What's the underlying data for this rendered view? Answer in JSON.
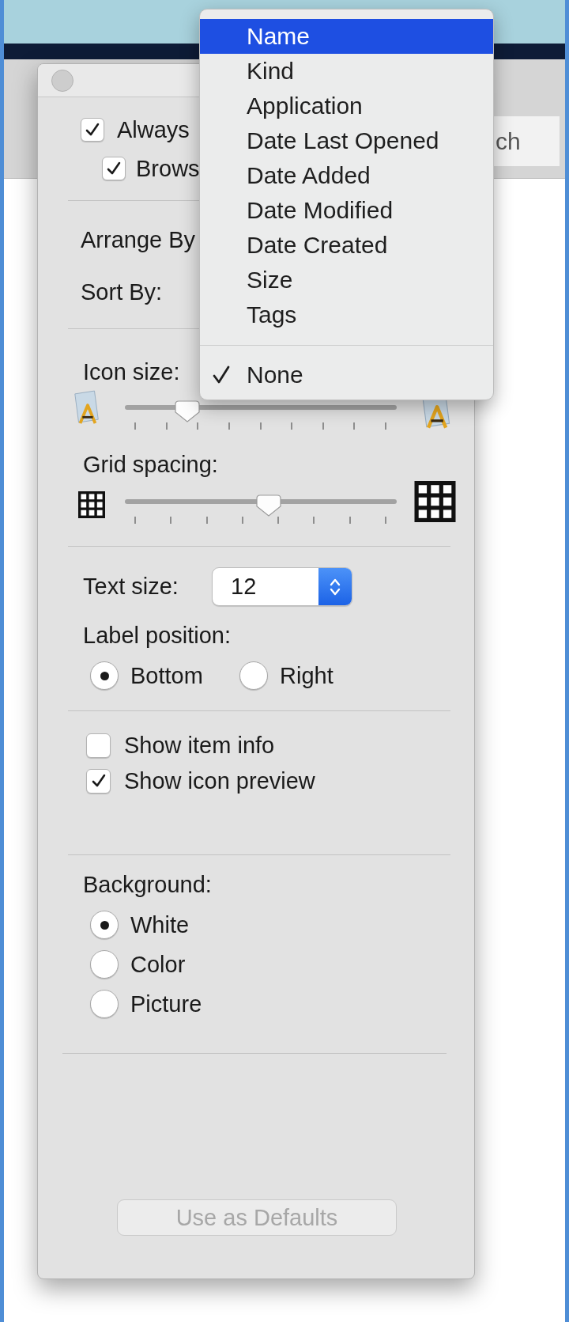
{
  "finder_window": {
    "search_field": {
      "placeholder": "ch"
    }
  },
  "view_options": {
    "checkboxes": [
      {
        "label": "Always",
        "checked": true,
        "children": [
          {
            "label": "Brows",
            "checked": true
          }
        ]
      }
    ],
    "arrange_by": {
      "label": "Arrange By"
    },
    "sort_by": {
      "label": "Sort By:"
    },
    "icon_size": {
      "label": "Icon size:",
      "level": 0.23
    },
    "grid_spacing": {
      "label": "Grid spacing:",
      "level": 0.53
    },
    "text_size": {
      "label": "Text size:",
      "value": "12"
    },
    "label_position": {
      "label": "Label position:",
      "options": [
        {
          "label": "Bottom",
          "selected": true
        },
        {
          "label": "Right",
          "selected": false
        }
      ]
    },
    "show_options": [
      {
        "label": "Show item info",
        "checked": false
      },
      {
        "label": "Show icon preview",
        "checked": true
      }
    ],
    "background": {
      "label": "Background:",
      "options": [
        {
          "label": "White",
          "selected": true
        },
        {
          "label": "Color",
          "selected": false
        },
        {
          "label": "Picture",
          "selected": false
        }
      ]
    },
    "defaults_button": {
      "label": "Use as Defaults",
      "disabled": true
    }
  },
  "sort_menu": {
    "sections": [
      {
        "items": [
          {
            "label": "Name",
            "highlighted": true,
            "checked": false
          },
          {
            "label": "Kind",
            "highlighted": false,
            "checked": false
          },
          {
            "label": "Application",
            "highlighted": false,
            "checked": false
          },
          {
            "label": "Date Last Opened",
            "highlighted": false,
            "checked": false
          },
          {
            "label": "Date Added",
            "highlighted": false,
            "checked": false
          },
          {
            "label": "Date Modified",
            "highlighted": false,
            "checked": false
          },
          {
            "label": "Date Created",
            "highlighted": false,
            "checked": false
          },
          {
            "label": "Size",
            "highlighted": false,
            "checked": false
          },
          {
            "label": "Tags",
            "highlighted": false,
            "checked": false
          }
        ]
      },
      {
        "items": [
          {
            "label": "None",
            "highlighted": false,
            "checked": true
          }
        ]
      }
    ]
  }
}
